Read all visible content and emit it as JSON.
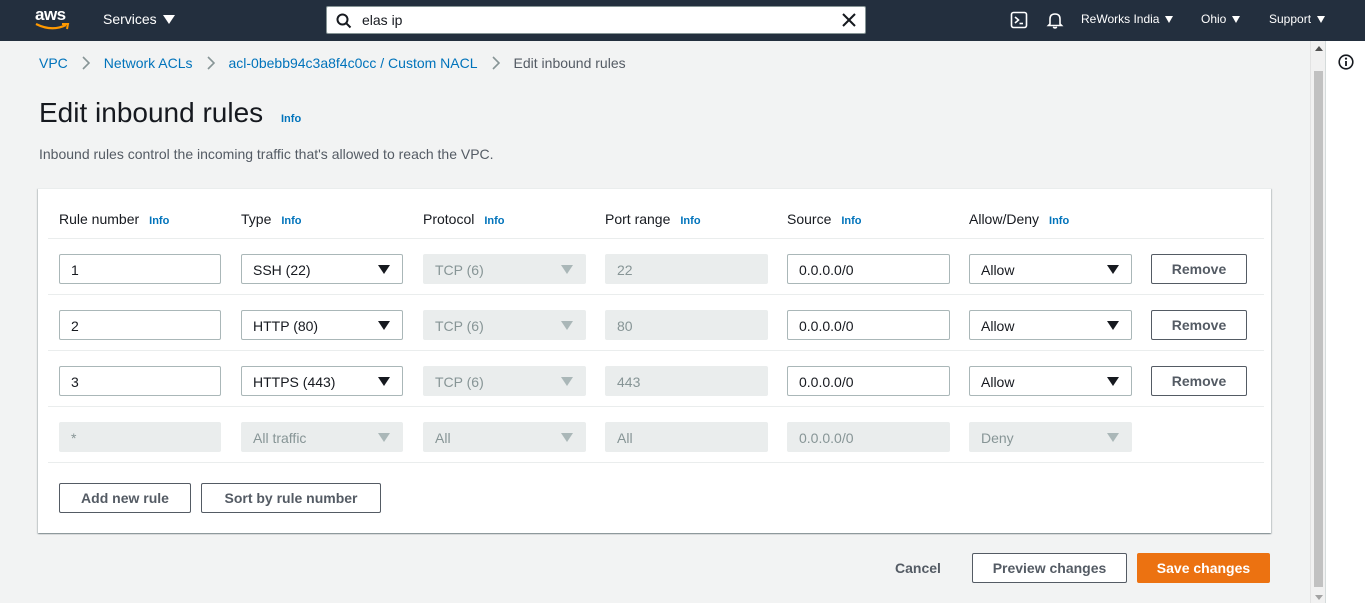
{
  "nav": {
    "logo_text": "aws",
    "services_label": "Services",
    "search_value": "elas ip",
    "account_label": "ReWorks India",
    "region_label": "Ohio",
    "support_label": "Support",
    "icons": [
      "cloudshell-icon",
      "bell-icon"
    ]
  },
  "breadcrumb": [
    {
      "label": "VPC"
    },
    {
      "label": "Network ACLs"
    },
    {
      "label": "acl-0bebb94c3a8f4c0cc / Custom NACL"
    },
    {
      "label": "Edit inbound rules"
    }
  ],
  "page": {
    "title": "Edit inbound rules",
    "info_label": "Info",
    "description": "Inbound rules control the incoming traffic that's allowed to reach the VPC."
  },
  "table": {
    "headers": [
      {
        "label": "Rule number",
        "info": "Info"
      },
      {
        "label": "Type",
        "info": "Info"
      },
      {
        "label": "Protocol",
        "info": "Info"
      },
      {
        "label": "Port range",
        "info": "Info"
      },
      {
        "label": "Source",
        "info": "Info"
      },
      {
        "label": "Allow/Deny",
        "info": "Info"
      }
    ],
    "rows": [
      {
        "rule": "1",
        "type": "SSH (22)",
        "protocol": "TCP (6)",
        "port": "22",
        "source": "0.0.0.0/0",
        "action": "Allow",
        "remove": "Remove"
      },
      {
        "rule": "2",
        "type": "HTTP (80)",
        "protocol": "TCP (6)",
        "port": "80",
        "source": "0.0.0.0/0",
        "action": "Allow",
        "remove": "Remove"
      },
      {
        "rule": "3",
        "type": "HTTPS (443)",
        "protocol": "TCP (6)",
        "port": "443",
        "source": "0.0.0.0/0",
        "action": "Allow",
        "remove": "Remove"
      },
      {
        "rule": "*",
        "type": "All traffic",
        "protocol": "All",
        "port": "All",
        "source": "0.0.0.0/0",
        "action": "Deny"
      }
    ],
    "add_rule_label": "Add new rule",
    "sort_label": "Sort by rule number"
  },
  "footer": {
    "cancel_label": "Cancel",
    "preview_label": "Preview changes",
    "save_label": "Save changes"
  },
  "colors": {
    "nav_bg": "#232f3e",
    "link": "#0073bb",
    "primary": "#ec7211",
    "page_bg": "#f2f3f3"
  }
}
